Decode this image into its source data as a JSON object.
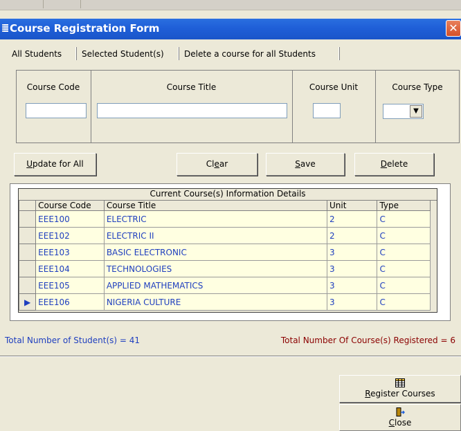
{
  "window": {
    "title": "Course Registration Form",
    "close_glyph": "✕"
  },
  "tabs": [
    {
      "label": "All Students"
    },
    {
      "label": "Selected Student(s)"
    },
    {
      "label": "Delete a course for all  Students"
    }
  ],
  "form": {
    "headers": {
      "course_code": "Course Code",
      "course_title": "Course Title",
      "course_unit": "Course Unit",
      "course_type": "Course Type"
    },
    "values": {
      "course_code": "",
      "course_title": "",
      "course_unit": "",
      "course_type": ""
    }
  },
  "buttons": {
    "update_for_all": {
      "mnemonic": "U",
      "rest": "pdate for All"
    },
    "clear": {
      "pre": "Cl",
      "mnemonic": "e",
      "rest": "ar"
    },
    "save": {
      "mnemonic": "S",
      "rest": "ave"
    },
    "delete": {
      "mnemonic": "D",
      "rest": "elete"
    },
    "register_courses": {
      "mnemonic": "R",
      "rest": "egister Courses",
      "icon": "grid-calendar-icon"
    },
    "close": {
      "mnemonic": "C",
      "rest": "lose",
      "icon": "door-exit-icon"
    }
  },
  "grid": {
    "caption": "Current Course(s)  Information Details",
    "columns": [
      "Course Code",
      "Course Title",
      "Unit",
      "Type"
    ],
    "rows": [
      {
        "code": "EEE100",
        "title": "ELECTRIC",
        "unit": "2",
        "type": "C"
      },
      {
        "code": "EEE102",
        "title": "ELECTRIC II",
        "unit": "2",
        "type": "C"
      },
      {
        "code": "EEE103",
        "title": "BASIC ELECTRONIC",
        "unit": "3",
        "type": "C"
      },
      {
        "code": "EEE104",
        "title": "TECHNOLOGIES",
        "unit": "3",
        "type": "C"
      },
      {
        "code": "EEE105",
        "title": "APPLIED MATHEMATICS",
        "unit": "3",
        "type": "C"
      },
      {
        "code": "EEE106",
        "title": "NIGERIA CULTURE",
        "unit": "3",
        "type": "C"
      }
    ],
    "current_row_marker": "▶"
  },
  "status": {
    "students": "Total Number of Student(s) = 41",
    "courses": "Total Number Of Course(s) Registered = 6"
  },
  "colors": {
    "titlebar": "#1f5fd8",
    "dialog_bg": "#ECE9D8",
    "grid_cell_bg": "#FFFFE1",
    "grid_text": "#1f3fbf",
    "status_right": "#8B0000"
  }
}
